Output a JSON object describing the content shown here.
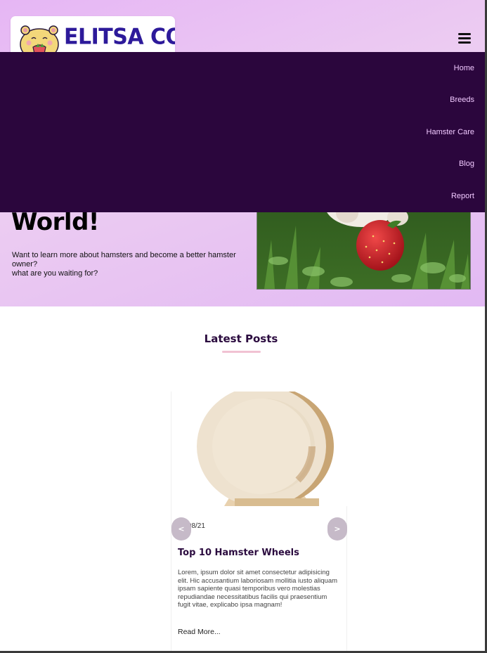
{
  "header": {
    "logo_text": "ELITSA CO",
    "menu_icon": "hamburger-icon"
  },
  "nav": {
    "items": [
      {
        "label": "Home"
      },
      {
        "label": "Breeds"
      },
      {
        "label": "Hamster Care"
      },
      {
        "label": "Blog"
      },
      {
        "label": "Report"
      }
    ]
  },
  "hero": {
    "title": "World!",
    "line1": "Want to learn more about hamsters and become a better hamster owner?",
    "line2": "what are you waiting for?"
  },
  "latest_posts": {
    "heading": "Latest Posts",
    "prev_label": "<",
    "next_label": ">",
    "post": {
      "date": "21/08/21",
      "title": "Top 10 Hamster Wheels",
      "body": "Lorem, ipsum dolor sit amet consectetur adipisicing elit. Hic accusantium laboriosam mollitia iusto aliquam ipsam sapiente quasi temporibus vero molestias repudiandae necessitatibus facilis qui praesentium fugit vitae, explicabo ipsa magnam!",
      "link": "Read More..."
    }
  },
  "colors": {
    "hero_bg": "#e6b6f4",
    "nav_bg": "#2b063d",
    "nav_text": "#f1c9ff",
    "logo_text": "#2d1a9a",
    "heading": "#2b0b3f",
    "accent_underline": "#f1c2d3"
  }
}
